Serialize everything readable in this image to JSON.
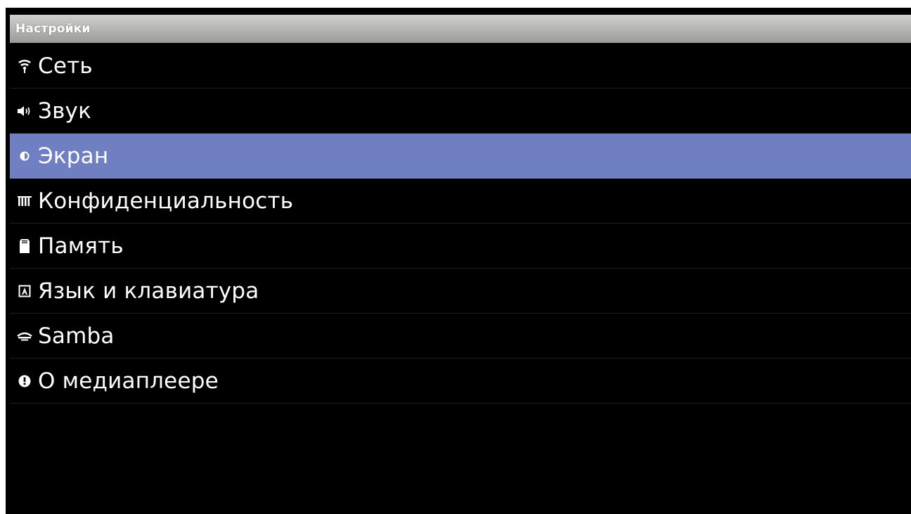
{
  "header": {
    "title": "Настройки"
  },
  "settings": {
    "items": [
      {
        "label": "Сеть",
        "icon": "wifi-icon",
        "selected": false
      },
      {
        "label": "Звук",
        "icon": "speaker-icon",
        "selected": false
      },
      {
        "label": "Экран",
        "icon": "brightness-icon",
        "selected": true
      },
      {
        "label": "Конфиденциальность",
        "icon": "privacy-icon",
        "selected": false
      },
      {
        "label": "Память",
        "icon": "storage-icon",
        "selected": false
      },
      {
        "label": "Язык и клавиатура",
        "icon": "keyboard-icon",
        "selected": false
      },
      {
        "label": "Samba",
        "icon": "samba-icon",
        "selected": false
      },
      {
        "label": "О медиаплеере",
        "icon": "info-icon",
        "selected": false
      }
    ]
  },
  "colors": {
    "background": "#000000",
    "selected": "#6f7fc2",
    "title_bar": "#b3b4b0",
    "text": "#ffffff"
  }
}
